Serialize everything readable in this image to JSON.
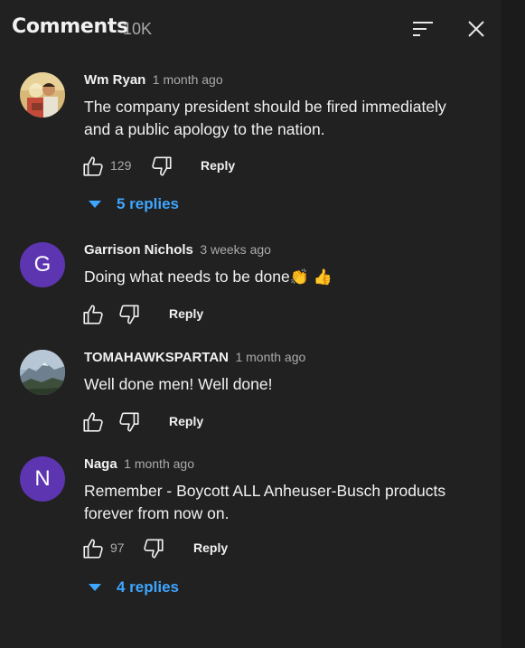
{
  "header": {
    "title": "Comments",
    "count": "10K",
    "icons": [
      "sort-icon",
      "close-icon"
    ]
  },
  "comments": [
    {
      "author": "Wm Ryan",
      "time": "1 month ago",
      "text": "The company president should be fired immediately and a public apology to the nation.",
      "likes": "129",
      "reply_label": "Reply",
      "replies_label": "5 replies",
      "avatar": "photo"
    },
    {
      "author": "Garrison Nichols",
      "time": "3 weeks ago",
      "text": "Doing what needs to be done",
      "emojis": "👏 👍",
      "likes": "",
      "reply_label": "Reply",
      "avatar_letter": "G"
    },
    {
      "author": "TOMAHAWKSPARTAN",
      "time": "1 month ago",
      "text": "Well done men! Well done!",
      "likes": "",
      "reply_label": "Reply",
      "avatar": "landscape"
    },
    {
      "author": "Naga",
      "time": "1 month ago",
      "text": "Remember - Boycott ALL Anheuser-Busch products forever from now on.",
      "likes": "97",
      "reply_label": "Reply",
      "replies_label": "4 replies",
      "avatar_letter": "N"
    }
  ],
  "colors": {
    "background": "#212121",
    "accent_blue": "#3ea6ff",
    "avatar_purple": "#5e35b1"
  }
}
